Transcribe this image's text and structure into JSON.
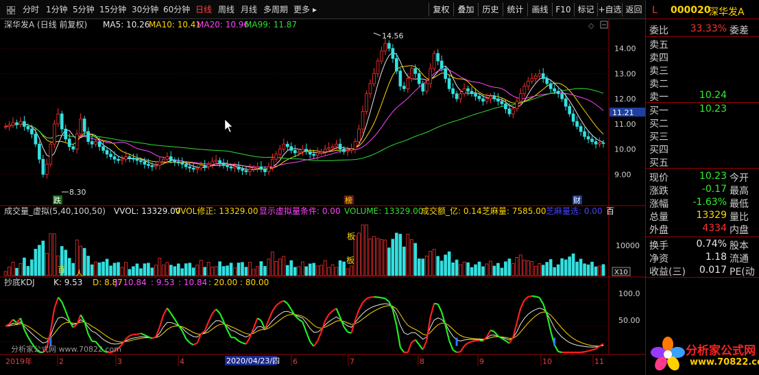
{
  "toolbar": {
    "periods": [
      "分时",
      "1分钟",
      "5分钟",
      "15分钟",
      "30分钟",
      "60分钟",
      "日线",
      "周线",
      "月线",
      "多周期",
      "更多"
    ],
    "active": "日线",
    "buttons": [
      "复权",
      "叠加",
      "历史",
      "统计",
      "画线",
      "F10",
      "标记",
      "+自选",
      "返回"
    ]
  },
  "quote": {
    "market_flag": "L",
    "code": "000020",
    "name": "深华发A",
    "weibi_label": "委比",
    "weibi_value": "33.33%",
    "weicha_label": "委差",
    "asks": [
      {
        "label": "卖五",
        "price": ""
      },
      {
        "label": "卖四",
        "price": ""
      },
      {
        "label": "卖三",
        "price": ""
      },
      {
        "label": "卖二",
        "price": ""
      },
      {
        "label": "卖一",
        "price": "10.24"
      }
    ],
    "bids": [
      {
        "label": "买一",
        "price": "10.23"
      },
      {
        "label": "买二",
        "price": ""
      },
      {
        "label": "买三",
        "price": ""
      },
      {
        "label": "买四",
        "price": ""
      },
      {
        "label": "买五",
        "price": ""
      }
    ],
    "stats": [
      {
        "label": "现价",
        "value": "10.23",
        "label2": "今开",
        "color": "green"
      },
      {
        "label": "涨跌",
        "value": "-0.17",
        "label2": "最高",
        "color": "green"
      },
      {
        "label": "涨幅",
        "value": "-1.63%",
        "label2": "最低",
        "color": "green"
      },
      {
        "label": "总量",
        "value": "13329",
        "label2": "量比",
        "color": "yellow"
      },
      {
        "label": "外盘",
        "value": "4334",
        "label2": "内盘",
        "color": "red"
      }
    ],
    "stats2": [
      {
        "label": "换手",
        "value": "0.74%",
        "label2": "股本"
      },
      {
        "label": "净资",
        "value": "1.18",
        "label2": "流通"
      },
      {
        "label": "收益(三)",
        "value": "0.017",
        "label2": "PE(动"
      }
    ]
  },
  "logo": {
    "line1": "分析家公式网",
    "line2": "www.70822.com"
  },
  "main_panel": {
    "title": "深华发A (日线 前复权)",
    "ma_labels": [
      {
        "text": "MA5: 10.26",
        "color": "#e8e8e8"
      },
      {
        "text": "MA10: 10.41",
        "color": "#ffd700"
      },
      {
        "text": "MA20: 10.96",
        "color": "#ff44ff"
      },
      {
        "text": "MA99: 11.87",
        "color": "#33dd33"
      }
    ],
    "y_ticks": [
      "14.00",
      "13.00",
      "12.00",
      "11.00",
      "10.00",
      "9.00"
    ],
    "price_tag": "11.21",
    "high_label": "14.56",
    "low_label": "8.30",
    "markers": [
      "跌",
      "榜",
      "财"
    ]
  },
  "volume_panel": {
    "labels": [
      {
        "text": "成交量_虚拟(5,40,100,50)",
        "color": "#d0d0d0"
      },
      {
        "text": "VVOL: 13329.00",
        "color": "#e8e8e8"
      },
      {
        "text": "VVOL修正: 13329.00",
        "color": "#ffd700"
      },
      {
        "text": "显示虚拟量条件: 0.00",
        "color": "#ff44ff"
      },
      {
        "text": "VOLUME: 13329.00",
        "color": "#33dd33"
      },
      {
        "text": "成交额_亿: 0.14",
        "color": "#ffd700"
      },
      {
        "text": "芝麻量: 7585.00",
        "color": "#ffd700"
      },
      {
        "text": "芝麻量选: 0.00",
        "color": "#4444ff"
      },
      {
        "text": "百",
        "color": "#e8e8e8"
      }
    ],
    "y_tick": "10000",
    "unit": "X10",
    "markers": [
      "板",
      "板",
      "百",
      "人"
    ]
  },
  "kdj_panel": {
    "labels": [
      {
        "text": "抄底KDJ",
        "color": "#d0d0d0"
      },
      {
        "text": "K: 9.53",
        "color": "#e8e8e8"
      },
      {
        "text": "D: 8.87",
        "color": "#ffd700"
      },
      {
        "text": "J: 10.84",
        "color": "#ff44ff"
      },
      {
        "text": ": 9.53",
        "color": "#ff44ff"
      },
      {
        "text": ": 10.84",
        "color": "#ff44ff"
      },
      {
        "text": ": 20.00",
        "color": "#ffd700"
      },
      {
        "text": ": 80.00",
        "color": "#ffd700"
      }
    ],
    "y_ticks": [
      "100.0",
      "50.00"
    ],
    "watermark": "分析家公式网 www.70822.com"
  },
  "date_axis": {
    "year": "2019年",
    "months": [
      "2",
      "3",
      "4",
      "5",
      "6",
      "7",
      "8",
      "9",
      "10",
      "11"
    ],
    "cursor_date": "2020/04/23/四"
  },
  "chart_data": {
    "type": "candlestick",
    "title": "深华发A (日线 前复权)",
    "y_range": [
      8.3,
      14.56
    ],
    "high": 14.56,
    "low": 8.3,
    "series": [
      {
        "name": "MA5",
        "last": 10.26
      },
      {
        "name": "MA10",
        "last": 10.41
      },
      {
        "name": "MA20",
        "last": 10.96
      },
      {
        "name": "MA99",
        "last": 11.87
      }
    ],
    "close": [
      10.9,
      10.95,
      11.05,
      10.98,
      11.1,
      10.9,
      10.8,
      10.6,
      10.2,
      9.6,
      9.0,
      9.4,
      10.2,
      11.0,
      11.4,
      10.8,
      10.4,
      10.1,
      10.0,
      10.6,
      11.2,
      10.7,
      10.3,
      10.2,
      10.3,
      10.1,
      9.95,
      9.8,
      9.7,
      9.6,
      9.55,
      9.6,
      9.7,
      9.65,
      9.6,
      9.55,
      9.5,
      9.4,
      9.35,
      9.3,
      9.35,
      9.5,
      9.6,
      9.7,
      9.55,
      9.5,
      9.45,
      9.4,
      9.3,
      9.25,
      9.2,
      9.25,
      9.35,
      9.3,
      9.4,
      9.5,
      9.55,
      9.45,
      9.35,
      9.3,
      9.25,
      9.3,
      9.2,
      9.15,
      9.1,
      9.2,
      9.25,
      9.3,
      9.2,
      9.1,
      9.3,
      9.6,
      9.8,
      10.0,
      10.2,
      10.1,
      9.95,
      9.85,
      9.9,
      10.0,
      9.9,
      9.8,
      9.75,
      9.85,
      9.9,
      10.0,
      10.05,
      10.1,
      10.2,
      10.0,
      9.9,
      9.95,
      10.0,
      10.3,
      10.8,
      11.5,
      12.2,
      12.6,
      13.0,
      13.5,
      13.9,
      14.2,
      14.0,
      13.6,
      13.1,
      12.5,
      12.4,
      12.8,
      13.2,
      13.0,
      12.6,
      12.3,
      12.6,
      13.2,
      13.8,
      13.5,
      13.2,
      12.8,
      12.4,
      12.2,
      12.0,
      12.2,
      12.4,
      12.3,
      12.2,
      12.1,
      12.0,
      11.9,
      12.0,
      12.1,
      12.0,
      11.9,
      11.8,
      11.6,
      11.4,
      11.6,
      11.9,
      12.2,
      12.5,
      12.7,
      12.8,
      12.9,
      13.0,
      12.8,
      12.6,
      12.4,
      12.3,
      12.2,
      12.0,
      11.7,
      11.4,
      11.1,
      10.9,
      10.7,
      10.5,
      10.4,
      10.3,
      10.2,
      10.25,
      10.23
    ]
  }
}
